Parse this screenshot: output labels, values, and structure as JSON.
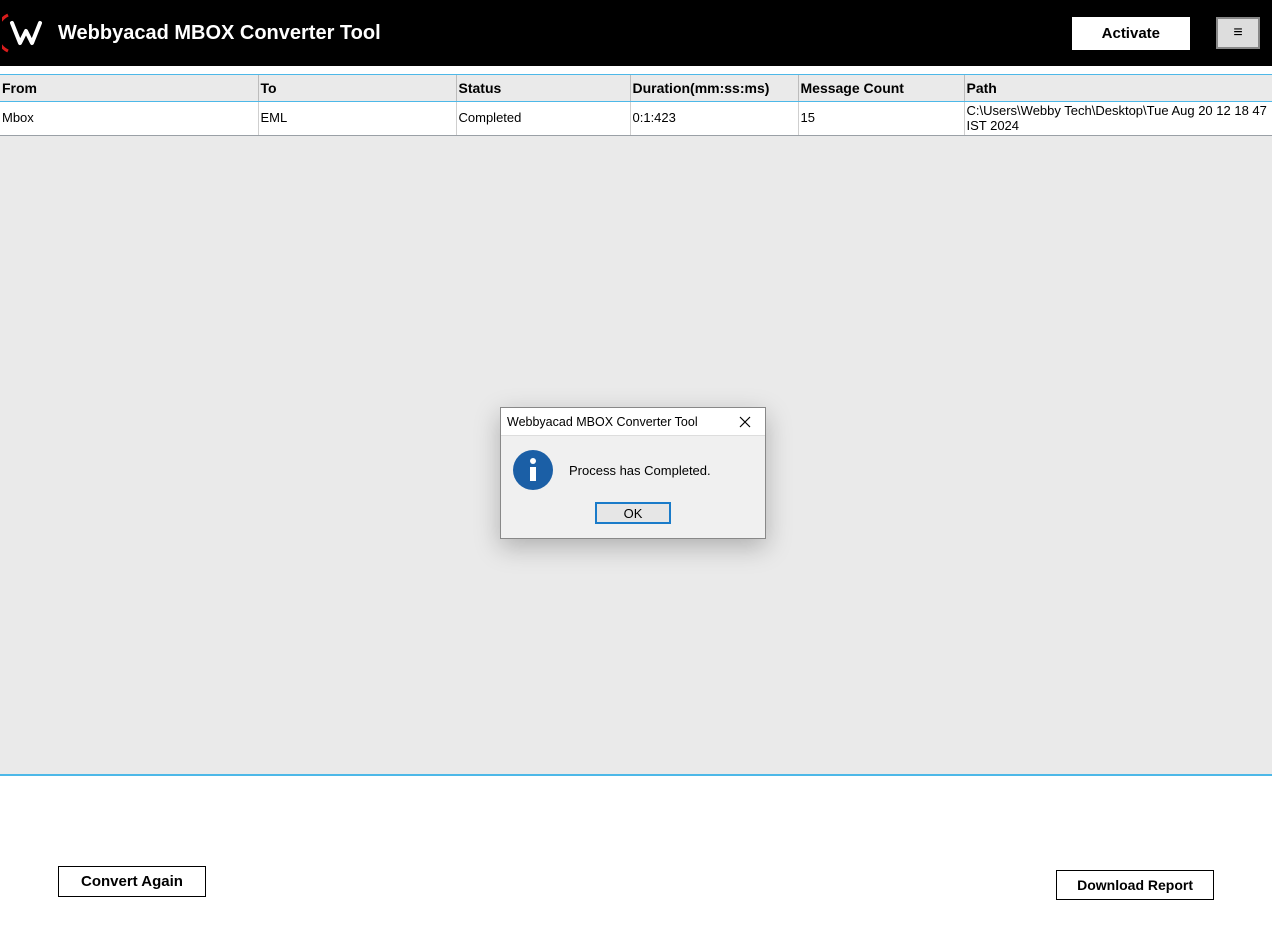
{
  "header": {
    "title": "Webbyacad MBOX Converter Tool",
    "activate_label": "Activate",
    "menu_glyph": "≡"
  },
  "table": {
    "columns": {
      "from": "From",
      "to": "To",
      "status": "Status",
      "duration": "Duration(mm:ss:ms)",
      "count": "Message Count",
      "path": "Path"
    },
    "rows": [
      {
        "from": "Mbox",
        "to": "EML",
        "status": "Completed",
        "duration": "0:1:423",
        "count": "15",
        "path": "C:\\Users\\Webby Tech\\Desktop\\Tue Aug 20 12 18 47 IST 2024"
      }
    ]
  },
  "footer": {
    "convert_again_label": "Convert Again",
    "download_report_label": "Download Report"
  },
  "dialog": {
    "title": "Webbyacad MBOX Converter Tool",
    "message": "Process has Completed.",
    "ok_label": "OK"
  }
}
